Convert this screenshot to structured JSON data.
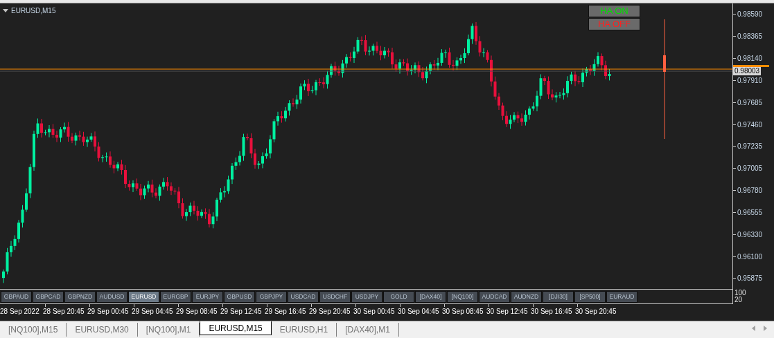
{
  "chart": {
    "title": "EURUSD,M15",
    "ha_buttons": [
      {
        "label": "HA ON",
        "kind": "on"
      },
      {
        "label": "HA OFF",
        "kind": "off"
      }
    ],
    "price_axis": [
      "0.98590",
      "0.98365",
      "0.98140",
      "0.97910",
      "0.97685",
      "0.97460",
      "0.97235",
      "0.97005",
      "0.96780",
      "0.96555",
      "0.96330",
      "0.96100",
      "0.95875"
    ],
    "bid_label": "0.98003",
    "indicator_scale": [
      "100",
      "20"
    ],
    "symbol_buttons": [
      {
        "label": "GBPAUD",
        "selected": false
      },
      {
        "label": "GBPCAD",
        "selected": false
      },
      {
        "label": "GBPNZD",
        "selected": false
      },
      {
        "label": "AUDUSD",
        "selected": false
      },
      {
        "label": "EURUSD",
        "selected": true
      },
      {
        "label": "EURGBP",
        "selected": false
      },
      {
        "label": "EURJPY",
        "selected": false
      },
      {
        "label": "GBPUSD",
        "selected": false
      },
      {
        "label": "GBPJPY",
        "selected": false
      },
      {
        "label": "USDCAD",
        "selected": false
      },
      {
        "label": "USDCHF",
        "selected": false
      },
      {
        "label": "USDJPY",
        "selected": false
      },
      {
        "label": "GOLD",
        "selected": false
      },
      {
        "label": "[DAX40]",
        "selected": false
      },
      {
        "label": "[NQ100]",
        "selected": false
      },
      {
        "label": "AUDCAD",
        "selected": false
      },
      {
        "label": "AUDNZD",
        "selected": false
      },
      {
        "label": "[DJI30]",
        "selected": false
      },
      {
        "label": "[SP500]",
        "selected": false
      },
      {
        "label": "EURAUD",
        "selected": false
      }
    ],
    "time_axis": [
      "28 Sep 2022",
      "28 Sep 20:45",
      "29 Sep 00:45",
      "29 Sep 04:45",
      "29 Sep 08:45",
      "29 Sep 12:45",
      "29 Sep 16:45",
      "29 Sep 20:45",
      "30 Sep 00:45",
      "30 Sep 04:45",
      "30 Sep 08:45",
      "30 Sep 12:45",
      "30 Sep 16:45",
      "30 Sep 20:45"
    ]
  },
  "tabs": [
    {
      "label": "[NQ100],M15",
      "selected": false
    },
    {
      "label": "EURUSD,M30",
      "selected": false
    },
    {
      "label": "[NQ100],M1",
      "selected": false
    },
    {
      "label": "EURUSD,M15",
      "selected": true
    },
    {
      "label": "EURUSD,H1",
      "selected": false
    },
    {
      "label": "[DAX40],M1",
      "selected": false
    }
  ]
}
